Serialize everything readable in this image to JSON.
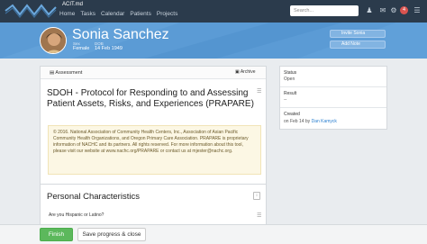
{
  "app": {
    "name": "ACIT.md",
    "nav": [
      "Home",
      "Tasks",
      "Calendar",
      "Patients",
      "Projects"
    ],
    "search_placeholder": "Search...",
    "notification_count": "4"
  },
  "patient": {
    "name": "Sonia Sanchez",
    "sex_label": "Sex",
    "sex": "Female",
    "dob_label": "DOB",
    "dob": "14 Feb 1949",
    "buttons": [
      "Invite Sonia",
      "Add Note"
    ]
  },
  "assessment": {
    "header_label": "Assessment",
    "archive_label": "Archive",
    "title": "SDOH - Protocol for Responding to and Assessing Patient Assets, Risks, and Experiences (PRAPARE)",
    "notice": "© 2016. National Association of Community Health Centers, Inc., Association of Asian Pacific Community Health Organizations, and Oregon Primary Care Association. PRAPARE is proprietary information of NACHC and its partners. All rights reserved. For more information about this tool, please visit our website at www.nachc.org/PRAPARE or contact us at mjester@nachc.org.",
    "section_title": "Personal Characteristics",
    "question": "Are you Hispanic or Latino?"
  },
  "side": {
    "status_label": "Status",
    "status_value": "Open",
    "result_label": "Result",
    "result_value": "--",
    "created_label": "Created",
    "created_prefix": "on Feb 14 by",
    "created_by": "Dan Kamyck"
  },
  "footer": {
    "finish_label": "Finish",
    "save_label": "Save progress & close"
  },
  "colors": {
    "topbar": "#2b3b4c",
    "banner": "#5b9bd5",
    "finish": "#5cb85c",
    "notice_bg": "#fcf7e4",
    "badge": "#d9534f"
  }
}
